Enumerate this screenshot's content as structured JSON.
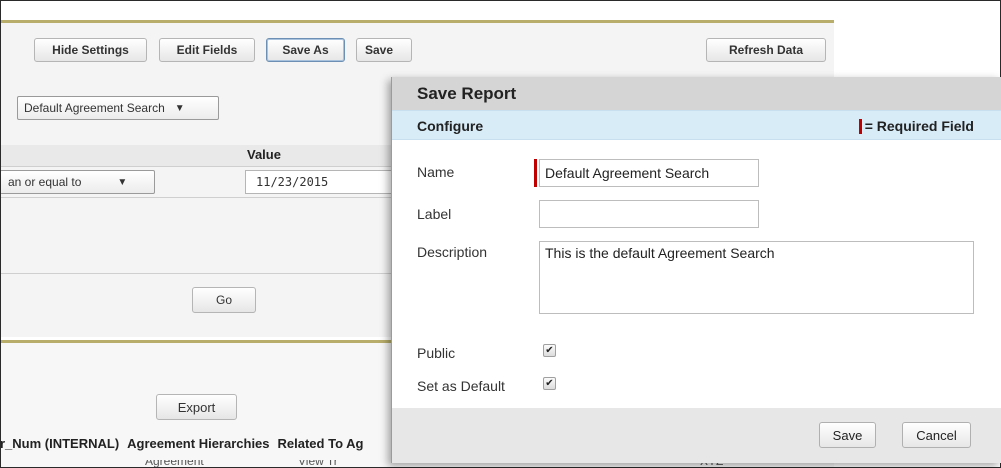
{
  "toolbar": {
    "hide_settings": "Hide Settings",
    "edit_fields": "Edit Fields",
    "save_as": "Save As",
    "save": "Save",
    "refresh_data": "Refresh Data"
  },
  "report_select": {
    "value": "Default Agreement Search"
  },
  "filter": {
    "value_header": "Value",
    "operator": "an or equal to",
    "date_value": "11/23/2015",
    "go": "Go"
  },
  "results": {
    "export": "Export",
    "columns": [
      "r_Num (INTERNAL)",
      "Agreement Hierarchies",
      "Related To Ag"
    ],
    "row_fragment": [
      "Agreement",
      "View Tr",
      "XYZ"
    ]
  },
  "dialog": {
    "title": "Save Report",
    "section": "Configure",
    "required_legend": "= Required Field",
    "name_label": "Name",
    "name_value": "Default Agreement Search",
    "label_label": "Label",
    "label_value": "",
    "description_label": "Description",
    "description_value": "This is the default Agreement Search",
    "public_label": "Public",
    "public_checked": true,
    "default_label": "Set as Default",
    "default_checked": true,
    "save_button": "Save",
    "cancel_button": "Cancel"
  },
  "colors": {
    "required_marker": "#c00000",
    "section_bg": "#d8ecf8",
    "header_bg": "#d5d5d5",
    "panel_accent": "#b8ad6a"
  }
}
